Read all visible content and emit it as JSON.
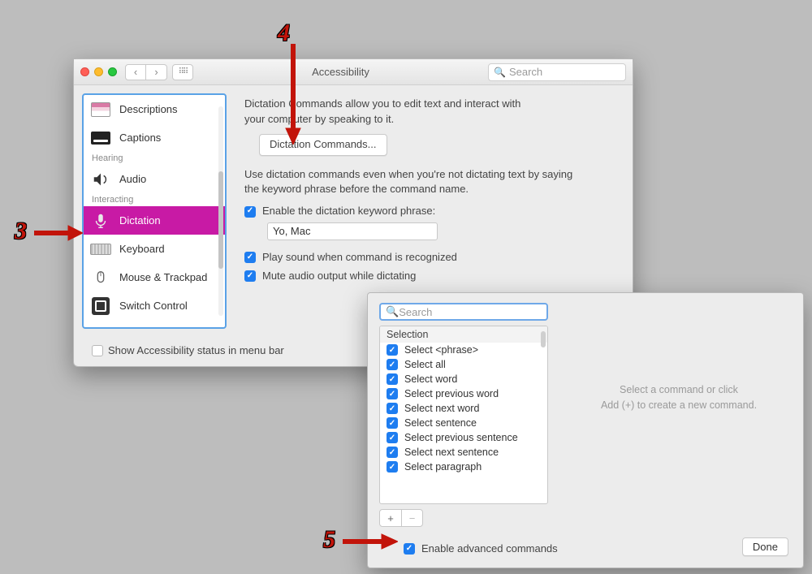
{
  "main_window": {
    "title": "Accessibility",
    "search_placeholder": "Search",
    "sidebar": {
      "items": [
        {
          "label": "Descriptions",
          "selected": false
        },
        {
          "label": "Captions",
          "selected": false
        }
      ],
      "section_hearing": "Hearing",
      "items_hearing": [
        {
          "label": "Audio",
          "selected": false
        }
      ],
      "section_interacting": "Interacting",
      "items_interacting": [
        {
          "label": "Dictation",
          "selected": true
        },
        {
          "label": "Keyboard",
          "selected": false
        },
        {
          "label": "Mouse & Trackpad",
          "selected": false
        },
        {
          "label": "Switch Control",
          "selected": false
        }
      ]
    },
    "footer_checkbox": "Show Accessibility status in menu bar",
    "content": {
      "intro": "Dictation Commands allow you to edit text and interact with your computer by speaking to it.",
      "dictation_commands_btn": "Dictation Commands...",
      "use_text": "Use dictation commands even when you're not dictating text by saying the keyword phrase before the command name.",
      "enable_keyword_label": "Enable the dictation keyword phrase:",
      "keyword_value": "Yo, Mac",
      "play_sound_label": "Play sound when command is recognized",
      "mute_label": "Mute audio output while dictating"
    }
  },
  "commands_window": {
    "search_placeholder": "Search",
    "list_header": "Selection",
    "commands": [
      {
        "label": "Select <phrase>",
        "enabled": true
      },
      {
        "label": "Select all",
        "enabled": true
      },
      {
        "label": "Select word",
        "enabled": true
      },
      {
        "label": "Select previous word",
        "enabled": true
      },
      {
        "label": "Select next word",
        "enabled": true
      },
      {
        "label": "Select sentence",
        "enabled": true
      },
      {
        "label": "Select previous sentence",
        "enabled": true
      },
      {
        "label": "Select next sentence",
        "enabled": true
      },
      {
        "label": "Select paragraph",
        "enabled": true
      }
    ],
    "hint_line1": "Select a command or click",
    "hint_line2": "Add (+) to create a new command.",
    "enable_advanced_label": "Enable advanced commands",
    "done_label": "Done"
  },
  "annotations": {
    "n3": "3",
    "n4": "4",
    "n5": "5"
  }
}
